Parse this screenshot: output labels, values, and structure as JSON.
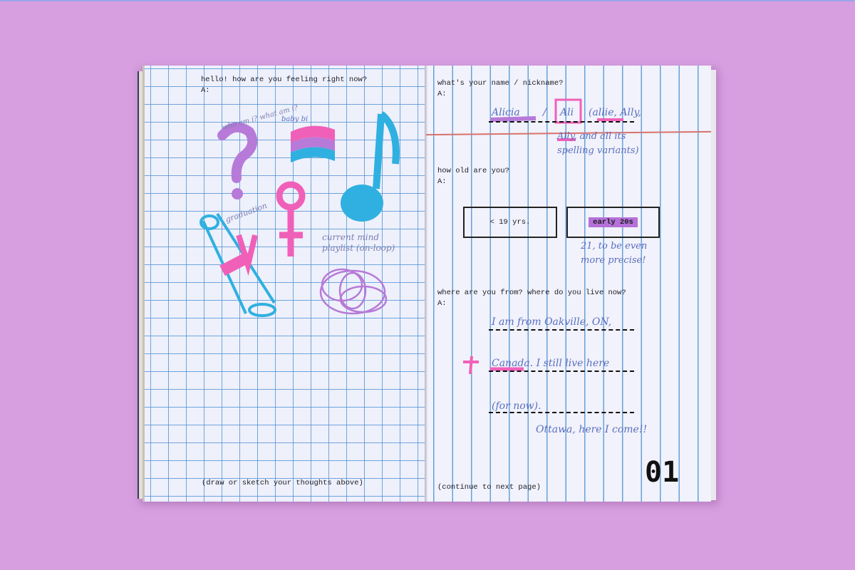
{
  "colors": {
    "background": "#d79fe0",
    "pink": "#f060b8",
    "purple": "#b77ad8",
    "cyan": "#2fb0e0",
    "ink": "#5a6fc0"
  },
  "left_page": {
    "question": "hello! how are you feeling right now?",
    "answer_label": "A:",
    "footer": "(draw or sketch your thoughts above)",
    "doodles": {
      "question_mark_note": "who am i? what am i?",
      "flag_note": "baby bi",
      "playlist_note": "current mind playlist (on-loop)",
      "scroll_note": "graduation"
    }
  },
  "right_page": {
    "q1": "what's your name / nickname?",
    "a1_label": "A:",
    "a1_handwritten": [
      "Alicia",
      "/",
      "Ali",
      "(allie, Ally,"
    ],
    "a1_note": "Ally, and all its spelling variants)",
    "q2": "how old are you?",
    "a2_label": "A:",
    "age_options": [
      "< 19 yrs.",
      "early 20s"
    ],
    "age_selected": "early 20s",
    "a2_note": "21, to be even more precise!",
    "q3": "where are you from? where do you live now?",
    "a3_label": "A:",
    "a3_lines": [
      "I am from Oakville, ON,",
      "Canada. I still live here",
      "(for now)."
    ],
    "a3_note": "Ottawa, here I come!!",
    "footer": "(continue to next page)",
    "page_number": "01"
  }
}
